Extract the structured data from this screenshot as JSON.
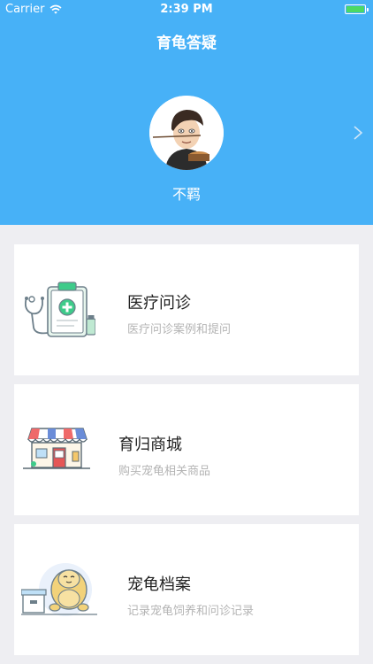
{
  "status_bar": {
    "carrier": "Carrier",
    "time": "2:39 PM",
    "battery_level": 1.0
  },
  "nav": {
    "title": "育龟答疑"
  },
  "profile": {
    "username": "不羁",
    "avatar_icon": "cartoon-avatar"
  },
  "colors": {
    "header_bg": "#47b1f7",
    "page_bg": "#eeeef2",
    "accent_green": "#3ecb8a",
    "battery_green": "#4cd964"
  },
  "cards": [
    {
      "title": "医疗问诊",
      "subtitle": "医疗问诊案例和提问",
      "icon": "medical-clipboard-icon"
    },
    {
      "title": "育归商城",
      "subtitle": "购买宠龟相关商品",
      "icon": "shop-storefront-icon"
    },
    {
      "title": "宠龟档案",
      "subtitle": "记录宠龟饲养和问诊记录",
      "icon": "turtle-archive-icon"
    }
  ]
}
